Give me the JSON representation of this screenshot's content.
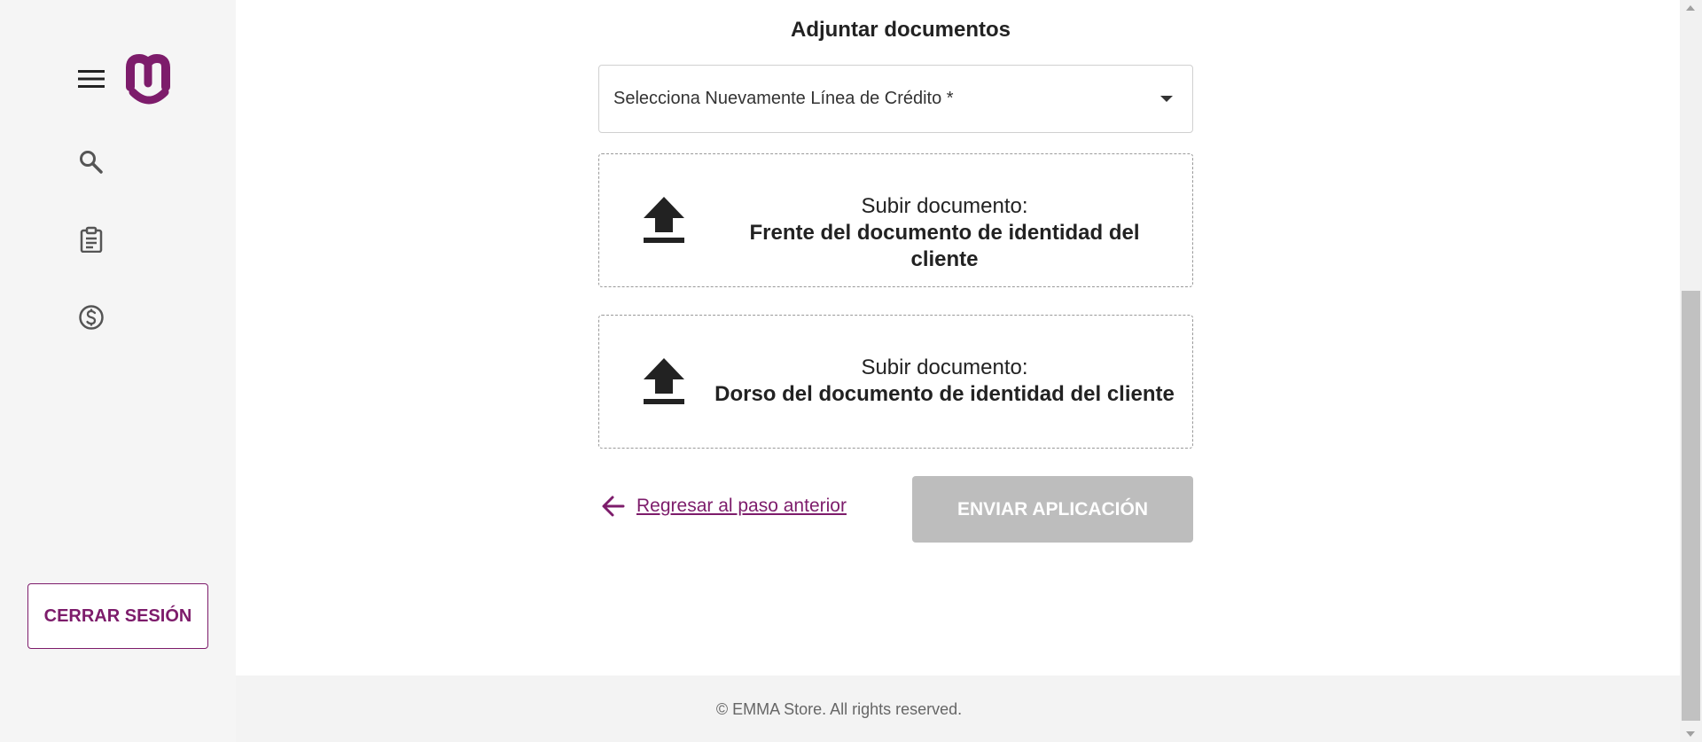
{
  "colors": {
    "brand": "#7d1c6b",
    "sidebar_bg": "#f5f5f5",
    "disabled_button": "#bdbdbd",
    "footer_bg": "#f3f3f3"
  },
  "sidebar": {
    "menu_icon": "hamburger-menu-icon",
    "logo_icon": "brand-m-logo-icon",
    "nav_items": [
      {
        "icon": "search-icon"
      },
      {
        "icon": "clipboard-icon"
      },
      {
        "icon": "dollar-circle-icon"
      }
    ],
    "logout_label": "CERRAR SESIÓN"
  },
  "main": {
    "title": "Adjuntar documentos",
    "credit_line_select": {
      "placeholder": "Selecciona Nuevamente Línea de Crédito *"
    },
    "uploads": [
      {
        "icon": "upload-icon",
        "line1": "Subir documento:",
        "line2": "Frente del documento de identidad del cliente"
      },
      {
        "icon": "upload-icon",
        "line1": "Subir documento:",
        "line2": "Dorso del documento de identidad del cliente"
      }
    ],
    "back_link": {
      "icon": "arrow-left-icon",
      "label": "Regresar al paso anterior"
    },
    "submit_label": "ENVIAR APLICACIÓN"
  },
  "footer": {
    "text": "© EMMA Store. All rights reserved."
  }
}
